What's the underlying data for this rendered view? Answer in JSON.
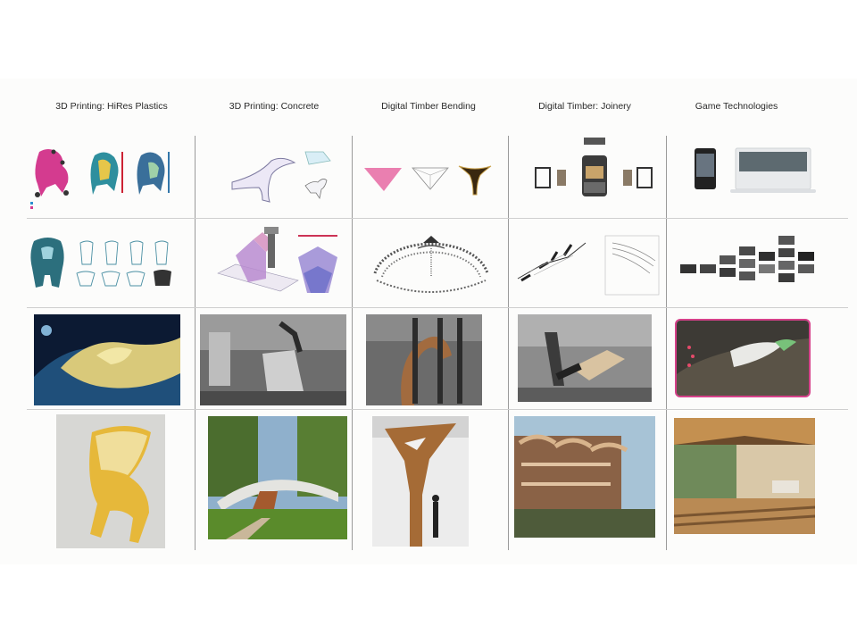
{
  "columns": [
    {
      "title": "3D Printing: HiRes Plastics"
    },
    {
      "title": "3D Printing: Concrete"
    },
    {
      "title": "Digital Timber Bending"
    },
    {
      "title": "Digital Timber: Joinery"
    },
    {
      "title": "Game Technologies"
    }
  ],
  "colors": {
    "background": "#ffffff",
    "sheet": "#fcfcfb",
    "divider": "#9a9a9a",
    "title_text": "#2a2a2a",
    "highlight_frame": "#d6418a"
  },
  "rows": [
    {
      "kind": "diagram"
    },
    {
      "kind": "diagram"
    },
    {
      "kind": "process-photo"
    },
    {
      "kind": "result-photo"
    }
  ]
}
